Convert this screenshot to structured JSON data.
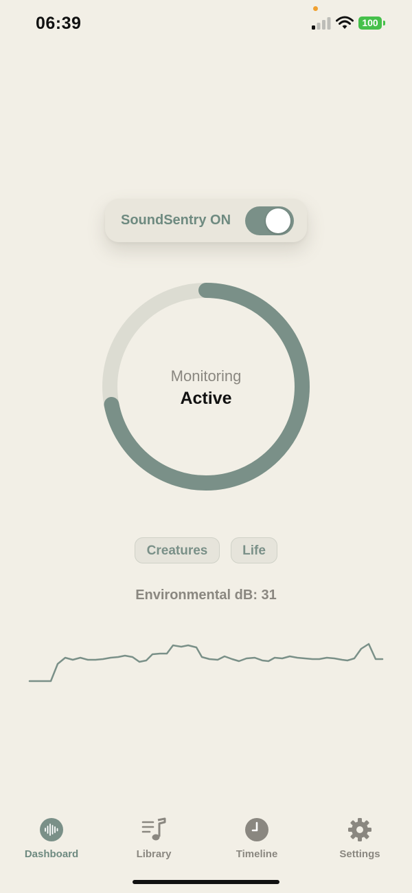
{
  "status_bar": {
    "time": "06:39",
    "battery": "100",
    "icons": [
      "signal-icon",
      "wifi-icon",
      "battery-icon"
    ]
  },
  "toggle": {
    "label": "SoundSentry ON",
    "state": true
  },
  "monitor": {
    "label": "Monitoring",
    "status": "Active",
    "progress": 0.72
  },
  "chips": [
    "Creatures",
    "Life"
  ],
  "environment": {
    "label": "Environmental dB: 31"
  },
  "tabs": [
    {
      "label": "Dashboard",
      "icon": "waveform-icon",
      "active": true
    },
    {
      "label": "Library",
      "icon": "music-list-icon",
      "active": false
    },
    {
      "label": "Timeline",
      "icon": "clock-icon",
      "active": false
    },
    {
      "label": "Settings",
      "icon": "gear-icon",
      "active": false
    }
  ],
  "colors": {
    "background": "#f2efe6",
    "accent": "#7a9088",
    "accent_text": "#6e8a80",
    "muted_text": "#8a8780",
    "track": "#dcdcd2"
  }
}
